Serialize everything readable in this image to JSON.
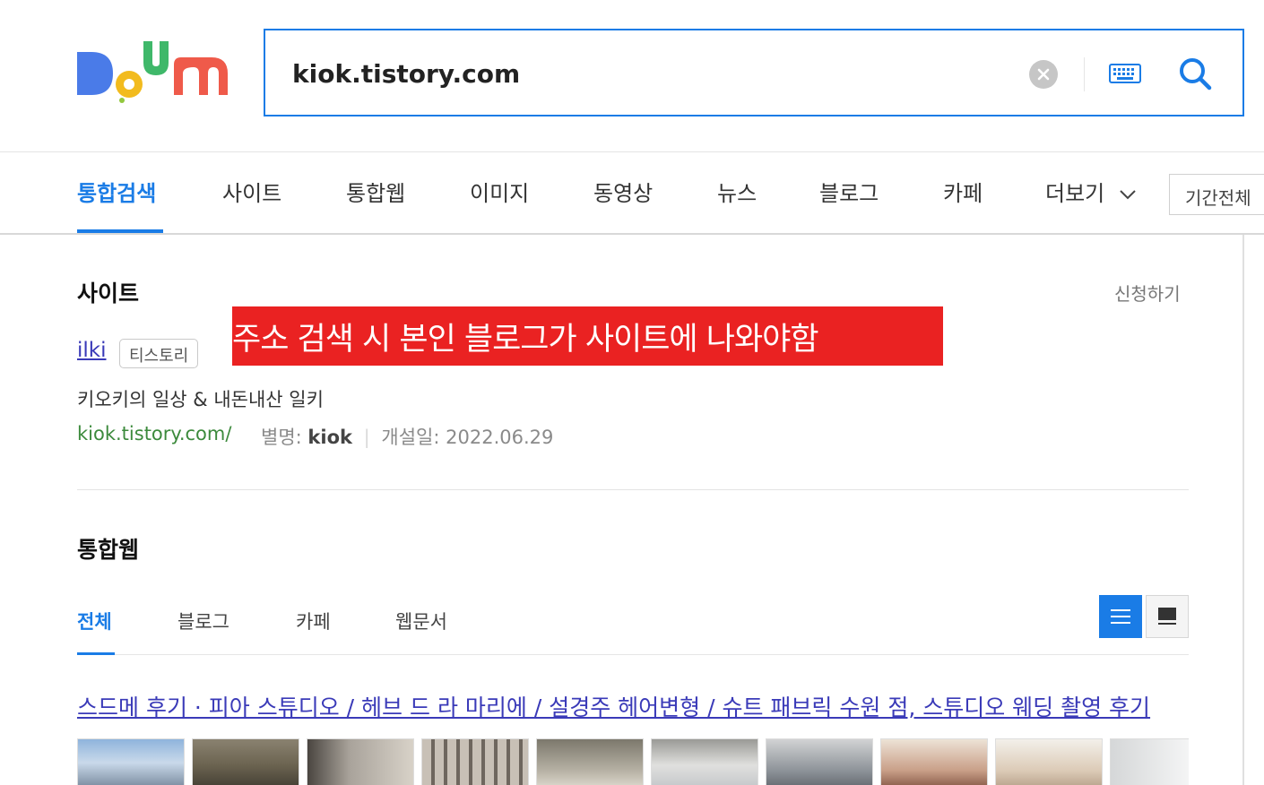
{
  "header": {
    "logo_text": "Daum",
    "search_value": "kiok.tistory.com"
  },
  "nav": {
    "tabs": [
      {
        "label": "통합검색",
        "active": true
      },
      {
        "label": "사이트"
      },
      {
        "label": "통합웹"
      },
      {
        "label": "이미지"
      },
      {
        "label": "동영상"
      },
      {
        "label": "뉴스"
      },
      {
        "label": "블로그"
      },
      {
        "label": "카페"
      },
      {
        "label": "더보기"
      }
    ],
    "period_label": "기간전체"
  },
  "site_section": {
    "title": "사이트",
    "apply_label": "신청하기",
    "annotation": "주소 검색 시 본인 블로그가 사이트에 나와야함",
    "site_name": "ilki",
    "site_badge": "티스토리",
    "description": "키오키의 일상 & 내돈내산 일키",
    "url": "kiok.tistory.com/",
    "alias_label": "별명:",
    "alias_value": "kiok",
    "opened_label": "개설일:",
    "opened_value": "2022.06.29"
  },
  "web_section": {
    "title": "통합웹",
    "sub_tabs": [
      {
        "label": "전체",
        "active": true
      },
      {
        "label": "블로그"
      },
      {
        "label": "카페"
      },
      {
        "label": "웹문서"
      }
    ],
    "result_title": "스드메 후기 · 피아 스튜디오 / 헤브 드 라 마리에 / 설경주 헤어변형 / 슈트 패브릭 수원 점, 스튜디오 웨딩 촬영 후기"
  },
  "colors": {
    "accent": "#1a7ce6",
    "link": "#3a3ab8",
    "url_green": "#3c8a3c",
    "banner_red": "#ea2222"
  }
}
